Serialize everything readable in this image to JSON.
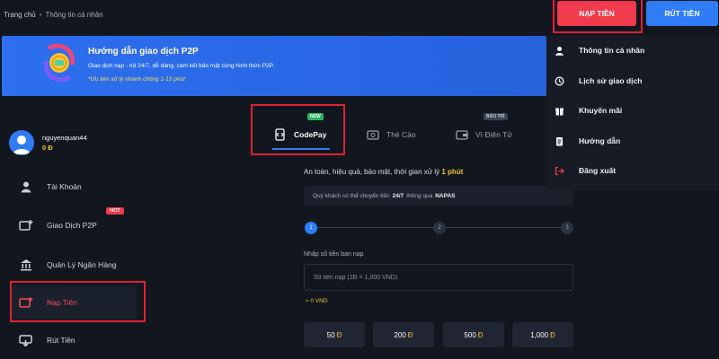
{
  "breadcrumb": {
    "home": "Trang chủ",
    "separator": "•",
    "current": "Thông tin cá nhân"
  },
  "banner": {
    "title": "Hướng dẫn giao dịch P2P",
    "description": "Giao dịch nạp - rút 24/7, dễ dàng, cam kết bảo mật cùng hình thức P2P.",
    "note": "*Ưu tiên xử lý nhanh chóng 1-15 phút"
  },
  "profile": {
    "username": "nguyenquan44",
    "balance": "0 Đ"
  },
  "sidebar": {
    "items": [
      {
        "label": "Tài Khoản",
        "icon": "user-icon"
      },
      {
        "label": "Giao Dịch P2P",
        "icon": "p2p-icon",
        "badge": "HOT"
      },
      {
        "label": "Quản Lý Ngân Hàng",
        "icon": "bank-icon"
      },
      {
        "label": "Nạp Tiền",
        "icon": "deposit-icon",
        "active": true
      },
      {
        "label": "Rút Tiền",
        "icon": "withdraw-icon"
      }
    ]
  },
  "tabs": [
    {
      "label": "CodePay",
      "badge": "NEW",
      "active": true,
      "icon": "codepay-icon"
    },
    {
      "label": "Thẻ Cào",
      "icon": "card-icon"
    },
    {
      "label": "Ví Điện Tử",
      "badge": "BẢO TRÌ",
      "icon": "wallet-icon"
    }
  ],
  "deposit": {
    "info_prefix": "An toàn, hiệu quả, bảo mật, thời gian xử lý",
    "info_highlight": "1 phút",
    "notice_prefix": "Quý khách có thể chuyển tiền",
    "notice_bold": "24/7",
    "notice_mid": "thông qua",
    "notice_bank": "NAPAS",
    "steps": [
      "1",
      "2",
      "3"
    ],
    "current_step": 1,
    "amount_label": "Nhập số tiền bạn nạp",
    "amount_placeholder": "Số tiền nạp (1Đ = 1,000 VND)",
    "equivalent": "≈ 0 VND",
    "quick_amounts": [
      "50",
      "200",
      "500",
      "1,000"
    ],
    "currency_symbol": "Đ"
  },
  "header_buttons": {
    "deposit": "NẠP TIỀN",
    "withdraw": "RÚT TIỀN"
  },
  "dropdown": {
    "items": [
      {
        "label": "Thông tin cá nhân",
        "icon": "user-icon"
      },
      {
        "label": "Lịch sử giao dịch",
        "icon": "history-icon"
      },
      {
        "label": "Khuyến mãi",
        "icon": "gift-icon"
      },
      {
        "label": "Hướng dẫn",
        "icon": "guide-icon"
      },
      {
        "label": "Đăng xuất",
        "icon": "logout-icon"
      }
    ]
  },
  "colors": {
    "background": "#12161f",
    "accent_red": "#ef3b4c",
    "accent_blue": "#2f7cf6",
    "highlight_yellow": "#f3c33a",
    "badge_green": "#27b85e"
  }
}
